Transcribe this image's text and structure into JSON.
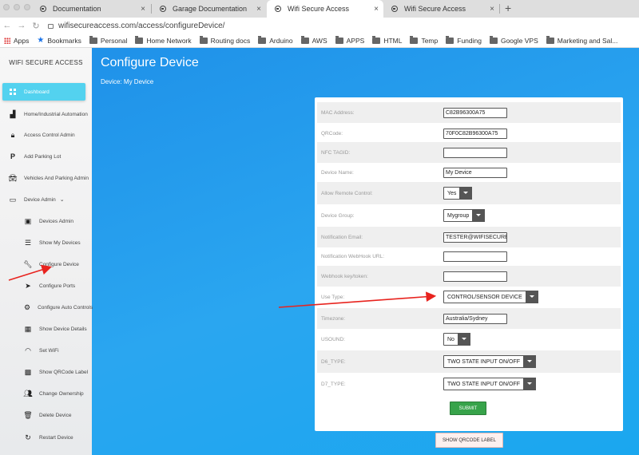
{
  "browser": {
    "tabs": [
      {
        "label": "Documentation",
        "active": false
      },
      {
        "label": "Garage Documentation",
        "active": false
      },
      {
        "label": "Wifi Secure Access",
        "active": true
      },
      {
        "label": "Wifi Secure Access",
        "active": false
      }
    ],
    "close_glyph": "×",
    "new_tab_glyph": "+",
    "url": "wifisecureaccess.com/access/configureDevice/",
    "bookmarks": [
      "Apps",
      "Bookmarks",
      "Personal",
      "Home Network",
      "Routing docs",
      "Arduino",
      "AWS",
      "APPS",
      "HTML",
      "Temp",
      "Funding",
      "Google VPS",
      "Marketing and Sal..."
    ]
  },
  "sidebar": {
    "brand": "WIFI SECURE ACCESS",
    "items": [
      {
        "label": "Dashboard",
        "icon": "dashboard-icon"
      },
      {
        "label": "Home/Industrial Automation",
        "icon": "automation-icon"
      },
      {
        "label": "Access Control Admin",
        "icon": "lock-icon"
      },
      {
        "label": "Add Parking Lot",
        "icon": "parking-icon"
      },
      {
        "label": "Vehicles And Parking Admin",
        "icon": "car-icon"
      },
      {
        "label": "Device Admin",
        "icon": "device-icon"
      },
      {
        "label": "Devices Admin",
        "icon": "devices-icon"
      },
      {
        "label": "Show My Devices",
        "icon": "list-icon"
      },
      {
        "label": "Configure Device",
        "icon": "wrench-icon"
      },
      {
        "label": "Configure Ports",
        "icon": "ports-icon"
      },
      {
        "label": "Configure Auto Controls",
        "icon": "gear-icon"
      },
      {
        "label": "Show Device Details",
        "icon": "details-icon"
      },
      {
        "label": "Set WiFi",
        "icon": "wifi-icon"
      },
      {
        "label": "Show QRCode Label",
        "icon": "qrcode-icon"
      },
      {
        "label": "Change Ownership",
        "icon": "users-icon"
      },
      {
        "label": "Delete Device",
        "icon": "trash-icon"
      },
      {
        "label": "Restart Device",
        "icon": "restart-icon"
      }
    ]
  },
  "main": {
    "title": "Configure Device",
    "subtitle": "Device: My Device"
  },
  "form": {
    "mac_label": "MAC Address:",
    "mac_value": "C82B96300A75",
    "qr_label": "QRCode:",
    "qr_value": "70F0C82B96300A75",
    "nfc_label": "NFC TAGID:",
    "nfc_value": "",
    "name_label": "Device Name:",
    "name_value": "My Device",
    "remote_label": "Allow Remote Control:",
    "remote_value": "Yes",
    "group_label": "Device Group:",
    "group_value": "Mygroup",
    "email_label": "Notification Email:",
    "email_value": "TESTER@WIFISECUREA",
    "webhook_label": "Notification WebHook URL:",
    "webhook_value": "",
    "token_label": "Webhook key/token:",
    "token_value": "",
    "usetype_label": "Use Type:",
    "usetype_value": "CONTROL/SENSOR DEVICE",
    "tz_label": "Timezone:",
    "tz_value": "Australia/Sydney",
    "usound_label": "USOUND:",
    "usound_value": "No",
    "d6_label": "D6_TYPE:",
    "d6_value": "TWO STATE INPUT ON/OFF",
    "d7_label": "D7_TYPE:",
    "d7_value": "TWO STATE INPUT ON/OFF",
    "submit_label": "SUBMIT",
    "qr_button_label": "SHOW QRCODE LABEL"
  },
  "colors": {
    "accent": "#53d2ef",
    "submit": "#37a34a",
    "annotation_arrow": "#e8231e"
  }
}
